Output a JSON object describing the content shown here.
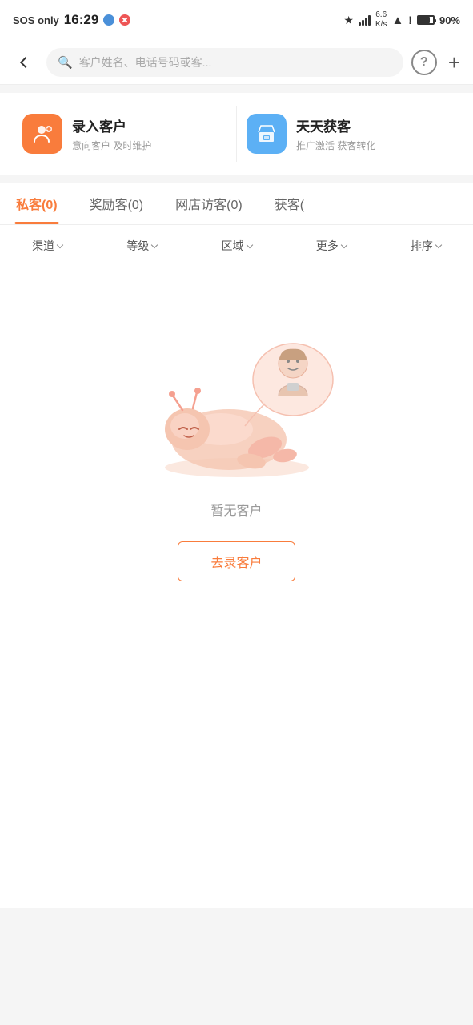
{
  "statusBar": {
    "left": {
      "label": "SOS only",
      "time": "16:29"
    },
    "right": {
      "battery": "90%"
    }
  },
  "navBar": {
    "backLabel": "back",
    "searchPlaceholder": "客户姓名、电话号码或客...",
    "helpLabel": "?",
    "addLabel": "+"
  },
  "banners": [
    {
      "id": "record-customer",
      "title": "录入客户",
      "subtitle": "意向客户 及时维护",
      "iconLabel": "add-user"
    },
    {
      "id": "daily-acquire",
      "title": "天天获客",
      "subtitle": "推广激活 获客转化",
      "iconLabel": "shop"
    }
  ],
  "tabs": [
    {
      "id": "private",
      "label": "私客(0)",
      "active": true
    },
    {
      "id": "reward",
      "label": "奖励客(0)",
      "active": false
    },
    {
      "id": "netshop",
      "label": "网店访客(0)",
      "active": false
    },
    {
      "id": "acquire",
      "label": "获客(",
      "active": false
    }
  ],
  "filters": [
    {
      "id": "channel",
      "label": "渠道"
    },
    {
      "id": "level",
      "label": "等级"
    },
    {
      "id": "area",
      "label": "区域"
    },
    {
      "id": "more",
      "label": "更多"
    },
    {
      "id": "sort",
      "label": "排序"
    }
  ],
  "emptyState": {
    "text": "暂无客户",
    "buttonLabel": "去录客户"
  }
}
